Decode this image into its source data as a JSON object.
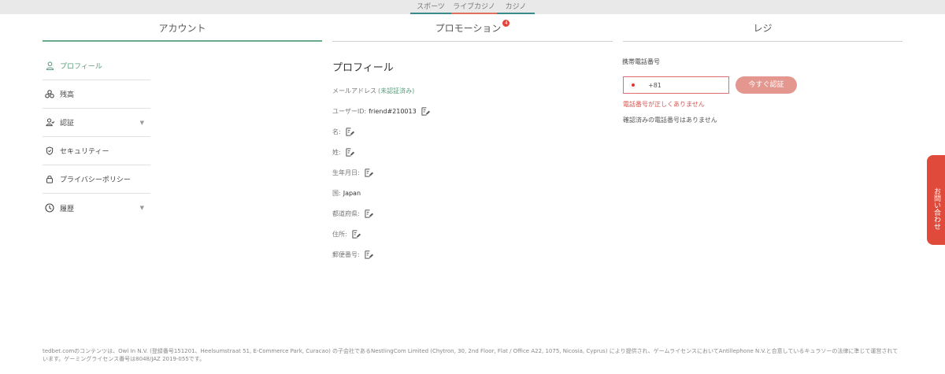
{
  "topnav": [
    "スポーツ",
    "ライブカジノ",
    "カジノ"
  ],
  "tabs": {
    "account": "アカウント",
    "promotion": "プロモーション",
    "promotion_badge": "4",
    "cashier": "レジ"
  },
  "sidebar": [
    {
      "label": "プロフィール",
      "icon": "person-icon"
    },
    {
      "label": "残高",
      "icon": "coins-icon"
    },
    {
      "label": "認証",
      "icon": "verify-icon"
    },
    {
      "label": "セキュリティー",
      "icon": "shield-icon"
    },
    {
      "label": "プライバシーポリシー",
      "icon": "lock-icon"
    },
    {
      "label": "履歴",
      "icon": "clock-icon"
    }
  ],
  "profile": {
    "title": "プロフィール",
    "email_label": "メールアドレス",
    "email_status": "(未認証済み)",
    "userid_label": "ユーザーID:",
    "userid_value": "friend#210013",
    "first_name_label": "名:",
    "last_name_label": "姓:",
    "birthdate_label": "生年月日:",
    "country_label": "国:",
    "country_value": "Japan",
    "prefecture_label": "都道府県:",
    "address_label": "住所:",
    "postal_label": "郵便番号:"
  },
  "cashier": {
    "phone_label": "携帯電話番号",
    "phone_prefix": "+81",
    "verify_button": "今すぐ認証",
    "error": "電話番号が正しくありません",
    "info": "確認済みの電話番号はありません"
  },
  "contact_tab": "お問い合わせ",
  "footer": "tedbet.comのコンテンツは、Owl In N.V. (登録番号151201、Heelsumstraat 51, E-Commerce Park, Curacao) の子会社であるNestlingCom Limited (Chytron, 30, 2nd Floor, Flat / Office A22, 1075, Nicosia, Cyprus) により提供され、ゲームライセンスにおいてAntillephone N.V.と合意しているキュラソーの法律に準じて運営されています。ゲーミングライセンス番号は8048/JAZ 2019-055です。"
}
